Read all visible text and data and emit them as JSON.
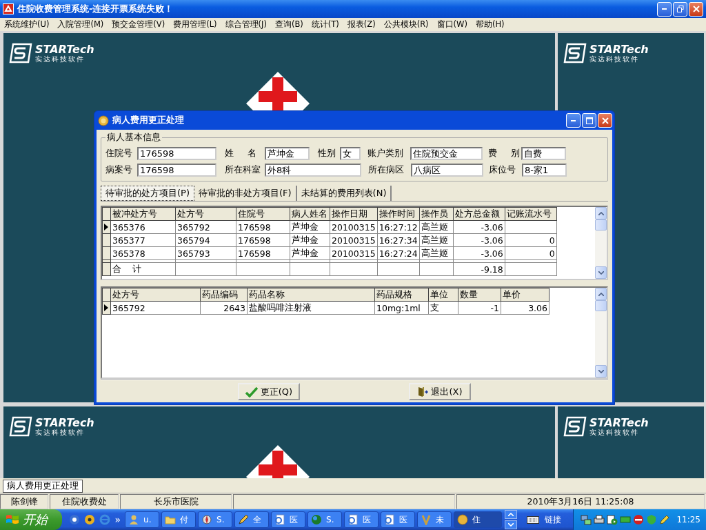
{
  "window": {
    "title": "住院收费管理系统-连接开票系统失败！"
  },
  "menu": [
    "系统维护(U)",
    "入院管理(M)",
    "预交金管理(V)",
    "费用管理(L)",
    "综合管理(J)",
    "查询(B)",
    "统计(T)",
    "报表(Z)",
    "公共模块(R)",
    "窗口(W)",
    "帮助(H)"
  ],
  "logos": [
    {
      "wordmark": "STARTech",
      "tagline": "实达科技软件"
    },
    {
      "wordmark": "STARTech",
      "tagline": "实达科技软件"
    },
    {
      "wordmark": "STARTech",
      "tagline": "实达科技软件"
    },
    {
      "wordmark": "STARTech",
      "tagline": "实达科技软件"
    }
  ],
  "dialog": {
    "title": "病人费用更正处理",
    "patient_info": {
      "legend": "病人基本信息",
      "rows": [
        [
          {
            "label": "住院号",
            "value": "176598"
          },
          {
            "label": "姓 名",
            "value": "芦坤金"
          },
          {
            "label": "性别",
            "value": "女"
          },
          {
            "label": "账户类别",
            "value": "住院预交金"
          },
          {
            "label": "费 别",
            "value": "自费"
          }
        ],
        [
          {
            "label": "病案号",
            "value": "176598"
          },
          {
            "label": "所在科室",
            "value": "外8科"
          },
          null,
          {
            "label": "所在病区",
            "value": "八病区"
          },
          {
            "label": "床位号",
            "value": "8-家1"
          }
        ]
      ]
    },
    "tabs": [
      {
        "label": "待审批的处方项目(P)",
        "selected": true
      },
      {
        "label": "待审批的非处方项目(F)",
        "selected": false
      },
      {
        "label": "未结算的费用列表(N)",
        "selected": false
      }
    ],
    "prescriptions": {
      "columns": [
        "被冲处方号",
        "处方号",
        "住院号",
        "病人姓名",
        "操作日期",
        "操作时间",
        "操作员",
        "处方总金额",
        "记账流水号"
      ],
      "rows": [
        {
          "kind": "data",
          "current": true,
          "cells": [
            "365376",
            "365792",
            "176598",
            "芦坤金",
            "20100315",
            "16:27:12",
            "高兰姬",
            "-3.06",
            null
          ]
        },
        {
          "kind": "data",
          "current": false,
          "cells": [
            "365377",
            "365794",
            "176598",
            "芦坤金",
            "20100315",
            "16:27:34",
            "高兰姬",
            "-3.06",
            "0"
          ]
        },
        {
          "kind": "data",
          "current": false,
          "cells": [
            "365378",
            "365793",
            "176598",
            "芦坤金",
            "20100315",
            "16:27:24",
            "高兰姬",
            "-3.06",
            "0"
          ]
        },
        {
          "kind": "total",
          "current": false,
          "cells": [
            "合 计",
            null,
            null,
            null,
            null,
            null,
            null,
            "-9.18",
            null
          ]
        }
      ]
    },
    "items": {
      "columns": [
        "处方号",
        "药品编码",
        "药品名称",
        "药品规格",
        "单位",
        "数量",
        "单价"
      ],
      "rows": [
        {
          "kind": "data",
          "current": true,
          "cells": [
            "365792",
            "2643",
            "盐酸吗啡注射液",
            "10mg:1ml",
            "支",
            "-1",
            "3.06"
          ]
        }
      ]
    },
    "buttons": [
      {
        "kind": "confirm",
        "label": "更正(Q)"
      },
      {
        "kind": "exit",
        "label": "退出(X)"
      }
    ]
  },
  "mdi_tabs": [
    {
      "label": "病人费用更正处理",
      "selected": true
    }
  ],
  "status_bar": [
    "陈剑锋",
    "住院收费处",
    "长乐市医院",
    "2010年3月16日  11:25:08"
  ],
  "taskbar": {
    "start": "开始",
    "quick_launch_more": "»",
    "tasks": [
      {
        "label": "u.",
        "selected": false
      },
      {
        "label": "付",
        "selected": false
      },
      {
        "label": "S.",
        "selected": false
      },
      {
        "label": "全",
        "selected": false
      },
      {
        "label": "医",
        "selected": false
      },
      {
        "label": "S.",
        "selected": false
      },
      {
        "label": "医",
        "selected": false
      },
      {
        "label": "医",
        "selected": false
      },
      {
        "label": "未",
        "selected": false
      },
      {
        "label": "住",
        "selected": true
      }
    ],
    "links": "链接",
    "clock": "11:25"
  }
}
